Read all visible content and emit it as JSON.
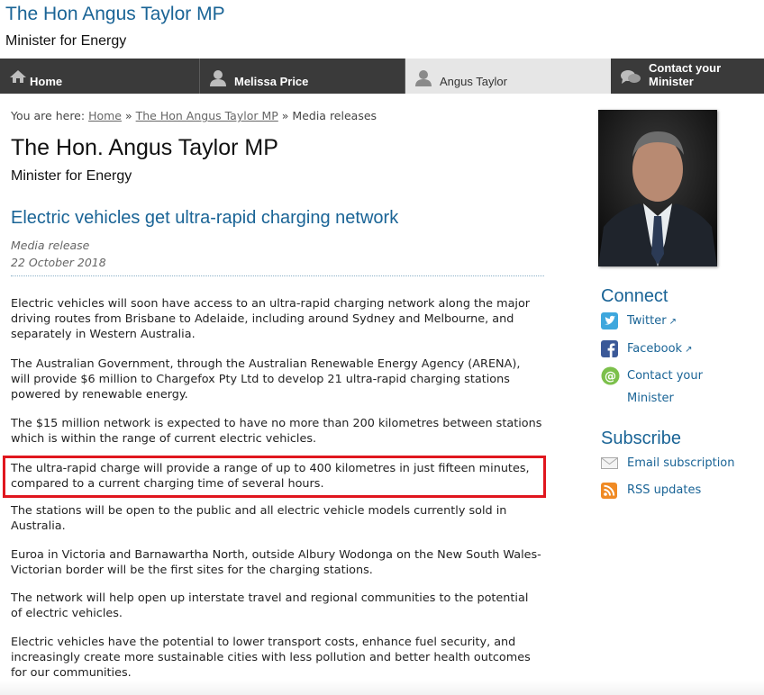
{
  "header": {
    "site_title": "The Hon Angus Taylor MP",
    "site_subtitle": "Minister for Energy"
  },
  "nav": {
    "items": [
      {
        "label": "Home",
        "icon": "home-icon"
      },
      {
        "label": "Melissa Price",
        "icon": "person-icon"
      },
      {
        "label": "Angus Taylor",
        "icon": "person-icon",
        "active": true
      },
      {
        "label": "Contact your Minister",
        "icon": "speech-bubbles-icon"
      }
    ]
  },
  "breadcrumb": {
    "prefix": "You are here:",
    "links": [
      "Home",
      "The Hon Angus Taylor MP"
    ],
    "separator": "»",
    "current": "Media releases"
  },
  "page": {
    "title": "The Hon. Angus Taylor MP",
    "subtitle": "Minister for Energy"
  },
  "article": {
    "title": "Electric vehicles get ultra-rapid charging network",
    "type": "Media release",
    "date": "22 October 2018",
    "paragraphs": [
      "Electric vehicles will soon have access to an ultra-rapid charging network along the major driving routes from Brisbane to Adelaide, including around Sydney and Melbourne, and separately in Western Australia.",
      "The Australian Government, through the Australian Renewable Energy Agency (ARENA), will provide $6 million to Chargefox Pty Ltd to develop 21 ultra-rapid charging stations powered by renewable energy.",
      "The $15 million network is expected to have no more than 200 kilometres between stations which is within the range of current electric vehicles.",
      "The ultra-rapid charge will provide a range of up to 400 kilometres in just fifteen minutes, compared to a current charging time of several hours.",
      "The stations will be open to the public and all electric vehicle models currently sold in Australia.",
      "Euroa in Victoria and Barnawartha North, outside Albury Wodonga on the New South Wales-Victorian border will be the first sites for the charging stations.",
      "The network will help open up interstate travel and regional communities to the potential of electric vehicles.",
      "Electric vehicles have the potential to lower transport costs, enhance fuel security, and increasingly create more sustainable cities with less pollution and better health outcomes for our communities."
    ],
    "highlight_color": "#e0161e"
  },
  "sidebar": {
    "connect_heading": "Connect",
    "connect_links": [
      {
        "label": "Twitter",
        "icon": "twitter-icon"
      },
      {
        "label": "Facebook",
        "icon": "facebook-icon"
      },
      {
        "label_line1": "Contact your",
        "label_line2": "Minister",
        "icon": "at-sign-icon"
      }
    ],
    "subscribe_heading": "Subscribe",
    "subscribe_links": [
      {
        "label": "Email subscription",
        "icon": "envelope-icon"
      },
      {
        "label": "RSS updates",
        "icon": "rss-icon"
      }
    ]
  },
  "colors": {
    "link": "#1a6496",
    "nav_bg": "#3a3a3a",
    "nav_active_bg": "#e6e6e6"
  }
}
